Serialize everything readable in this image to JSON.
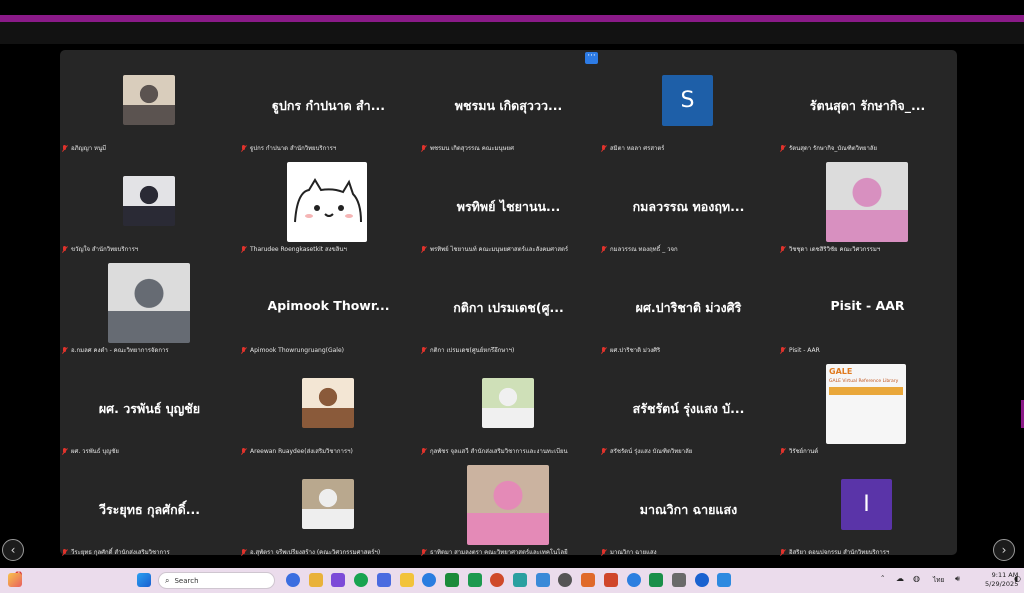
{
  "more_button_label": "···",
  "participants": [
    {
      "label": "อภิญญา หนูมี",
      "display": "photo",
      "photo_tone": [
        "#d9cdbc",
        "#5b5350"
      ]
    },
    {
      "label": "ฐูปกร กำปนาด สำนักวิทยบริการฯ",
      "display": "name",
      "avatar_name": "ฐูปกร กำปนาด สำ..."
    },
    {
      "label": "พชรมน เกิดสุวรรณ คณะมนุษยศ",
      "display": "name",
      "avatar_name": "พชรมน เกิดสุววว..."
    },
    {
      "label": "สมิตา หอลา ศรสาตร์",
      "display": "initial",
      "initial": "S",
      "color": "#1e5fa8"
    },
    {
      "label": "รัตนสุดา รักษากิจ_บัณฑิตวิทยาลัย",
      "display": "name",
      "avatar_name": "รัตนสุดา รักษากิจ_..."
    },
    {
      "label": "ขวัญใจ สำนักวิทยบริการฯ",
      "display": "photo",
      "photo_tone": [
        "#e3e3e6",
        "#2a2a35"
      ]
    },
    {
      "label": "Tharudee Roengkasetkit สงขลินฯ",
      "display": "cat",
      "color": "#ffffff"
    },
    {
      "label": "พรทิพย์ ไชยานนท์ คณะมนุษยศาสตร์และสังคมศาสตร์",
      "display": "name",
      "avatar_name": "พรทิพย์ ไชยานน..."
    },
    {
      "label": "กมลวรรณ ทองฤทธิ์ _ วจก",
      "display": "name",
      "avatar_name": "กมลวรรณ ทองฤท..."
    },
    {
      "label": "วิชชุดา เดชสิริวิชัย คณะวิศวกรรมฯ",
      "display": "photo",
      "photo_tone": [
        "#dcdcdc",
        "#d890c0"
      ]
    },
    {
      "label": "อ.กมลศ คงดำ - คณะวิทยาการจัดการ",
      "display": "photo",
      "photo_tone": [
        "#dcdcdc",
        "#666b73"
      ]
    },
    {
      "label": "Apimook Thowrungruang(Gale)",
      "display": "name",
      "avatar_name": "Apimook Thowr..."
    },
    {
      "label": "กติกา เปรมเดช(ศูนย์หกรึอึกษาฯ)",
      "display": "name",
      "avatar_name": "กติกา เปรมเดช(ศู..."
    },
    {
      "label": "ผศ.ปาริชาติ ม่วงศิริ",
      "display": "name",
      "avatar_name": "ผศ.ปาริชาติ ม่วงศิริ"
    },
    {
      "label": "Pisit - AAR",
      "display": "name",
      "avatar_name": "Pisit - AAR"
    },
    {
      "label": "ผศ. วรพันธ์ บุญชัย",
      "display": "name",
      "avatar_name": "ผศ. วรพันธ์ บุญชัย"
    },
    {
      "label": "Areewan Ruaydee(ส่งเสริมวิชาการฯ)",
      "display": "photo",
      "photo_tone": [
        "#f3e6d4",
        "#8a5a3a"
      ]
    },
    {
      "label": "กุลพัชร จุลแสวี สำนักส่งเสริมวิชาการและงานทะเบียน",
      "display": "photo",
      "photo_tone": [
        "#cfe0b8",
        "#f0f0f0"
      ]
    },
    {
      "label": "สรัชรัตน์ รุ่งแสง บัณฑิตวิทยาลัย",
      "display": "name",
      "avatar_name": "สรัชรัตน์ รุ่งแสง บั..."
    },
    {
      "label": "วิรัชย์กานต์",
      "display": "gale",
      "gale_text": "GALE",
      "gale_sub": "GALE Virtual Reference Library"
    },
    {
      "label": "วีระยุทธ กุลศักดิ์ สำนักส่งเสริมวิชาการ",
      "display": "name",
      "avatar_name": "วีระยุทธ กุลศักดิ์..."
    },
    {
      "label": "อ.สุพัตรา จรีพเปรียงสร้าง (คณะวิศวกรรมศาสตร์ฯ)",
      "display": "photo",
      "photo_tone": [
        "#b9a88e",
        "#eeeeee"
      ]
    },
    {
      "label": "ธาทิตมา สามลงตรา คณะวิทยาศาสตร์และเทคโนโลยี",
      "display": "photo",
      "photo_tone": [
        "#cbb3a0",
        "#e48ab7"
      ]
    },
    {
      "label": "มาณวิกา ฉายแสง",
      "display": "name",
      "avatar_name": "มาณวิกา ฉายแสง"
    },
    {
      "label": "อิสริยา ดอนปจกรรม สำนักวิทยบริการฯ",
      "display": "initial",
      "initial": "I",
      "color": "#5a34a8"
    }
  ],
  "nav": {
    "prev": "‹",
    "next": "›"
  },
  "taskbar": {
    "search_placeholder": "Search",
    "weather_badge": "3",
    "language": "ไทย",
    "time": "9:11 AM",
    "date": "5/29/2025"
  }
}
